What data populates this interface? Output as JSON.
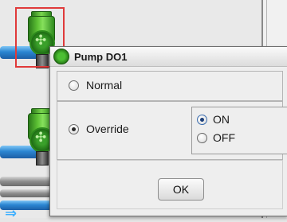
{
  "dialog": {
    "title": "Pump DO1",
    "icon": "pump-icon",
    "modes": [
      {
        "label": "Normal",
        "selected": false
      },
      {
        "label": "Override",
        "selected": true
      }
    ],
    "override_states": [
      {
        "label": "ON",
        "selected": true
      },
      {
        "label": "OFF",
        "selected": false
      }
    ],
    "ok_label": "OK"
  },
  "colors": {
    "selection_outline": "#e03a3a",
    "pump_green": "#4cbf33",
    "pipe_blue": "#2b86d2"
  }
}
